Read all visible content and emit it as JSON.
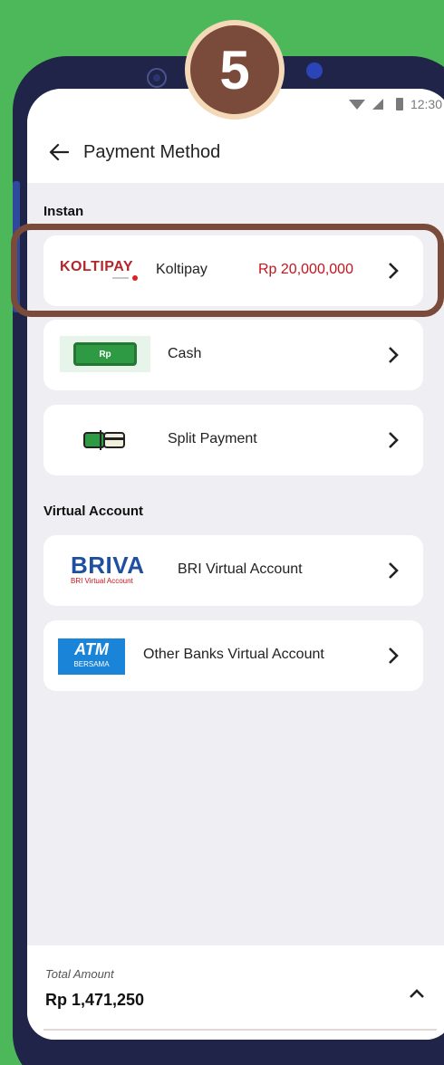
{
  "step_badge": "5",
  "status_bar": {
    "time": "12:30"
  },
  "header": {
    "title": "Payment Method"
  },
  "sections": {
    "instant": "Instan",
    "virtual_account": "Virtual Account"
  },
  "methods": {
    "koltipay": {
      "logo_text": "KOLTIPAY",
      "label": "Koltipay",
      "amount": "Rp 20,000,000"
    },
    "cash": {
      "label": "Cash",
      "icon_text": "Rp"
    },
    "split": {
      "label": "Split Payment"
    },
    "briva": {
      "logo_text": "BRIVA",
      "logo_sub": "BRI Virtual Account",
      "label": "BRI Virtual Account"
    },
    "atm": {
      "logo_text": "ATM",
      "logo_sub": "BERSAMA",
      "label": "Other Banks Virtual Account"
    }
  },
  "footer": {
    "total_label": "Total Amount",
    "total_value": "Rp 1,471,250"
  },
  "colors": {
    "background": "#4cb85a",
    "highlight": "#7a4a3a",
    "amount": "#c4141c",
    "briva_blue": "#1f4fa0",
    "atm_blue": "#1a84d8"
  }
}
